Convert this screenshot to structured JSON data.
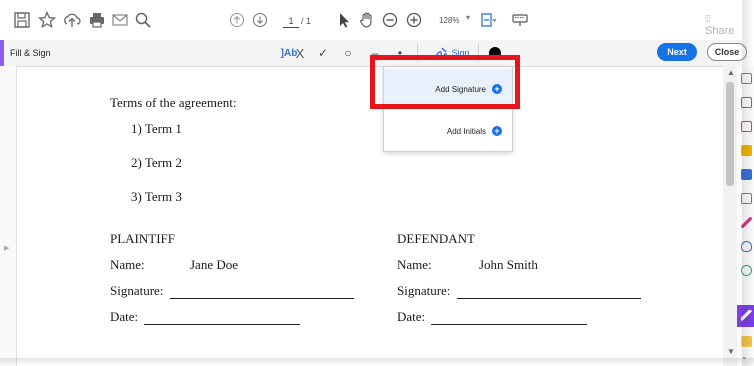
{
  "toolbar": {
    "page_current": "1",
    "page_total": "/ 1",
    "zoom": "128%",
    "share_label": "Share",
    "icons": [
      "save-icon",
      "star-icon",
      "upload-icon",
      "print-icon",
      "email-icon",
      "search-icon",
      "page-up-icon",
      "page-down-icon",
      "select-icon",
      "hand-icon",
      "zoom-out-icon",
      "zoom-in-icon",
      "fit-icon",
      "keyboard-icon"
    ]
  },
  "fill_sign": {
    "title": "Fill & Sign",
    "text_tool": "]Ab",
    "cross_tool": "X",
    "check_tool": "✓",
    "oval_tool": "○",
    "dash_tool": "–",
    "dot_tool": "•",
    "sign_label": "Sign",
    "next_label": "Next",
    "close_label": "Close",
    "accent_color": "#8b5cf6"
  },
  "dropdown": {
    "items": [
      {
        "label": "Add Signature"
      },
      {
        "label": "Add Initials"
      }
    ]
  },
  "document": {
    "heading": "Terms of the agreement:",
    "terms": [
      "1)  Term 1",
      "2)  Term 2",
      "3)  Term 3"
    ],
    "plaintiff": {
      "label": "PLAINTIFF",
      "name_label": "Name:",
      "name_value": "Jane Doe",
      "signature_label": "Signature:",
      "date_label": "Date:"
    },
    "defendant": {
      "label": "DEFENDANT",
      "name_label": "Name:",
      "name_value": "John Smith",
      "signature_label": "Signature:",
      "date_label": "Date:"
    }
  },
  "highlight_color": "#e8141c"
}
